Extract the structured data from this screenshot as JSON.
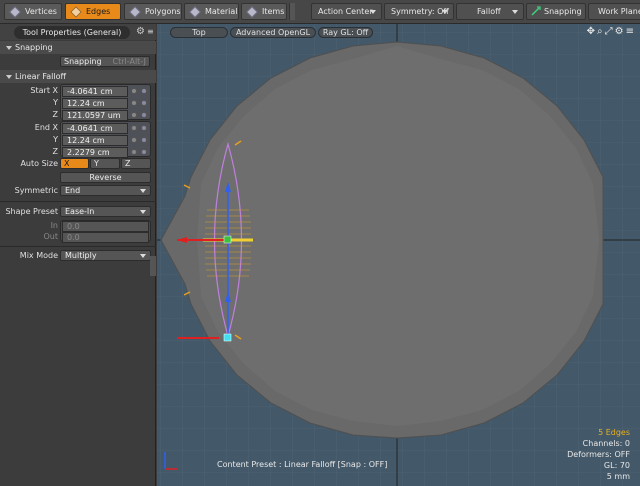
{
  "toolbar": {
    "modes": [
      {
        "label": "Vertices",
        "active": false
      },
      {
        "label": "Edges",
        "active": true
      },
      {
        "label": "Polygons",
        "active": false
      },
      {
        "label": "Materials",
        "active": false
      },
      {
        "label": "Items",
        "active": false
      }
    ],
    "action_center": "Action Center",
    "symmetry": "Symmetry: Off",
    "falloff": "Falloff",
    "snapping": "Snapping",
    "work_plane": "Work Plane"
  },
  "panel": {
    "title": "Tool Properties (General)",
    "snapping_section": "Snapping",
    "snapping_button": "Snapping",
    "snapping_shortcut": "Ctrl-Alt-J",
    "linear_falloff_section": "Linear Falloff",
    "start": {
      "label": "Start X",
      "y_label": "Y",
      "z_label": "Z",
      "x": "-4.0641 cm",
      "y": "12.24 cm",
      "z": "121.0597 um"
    },
    "end": {
      "label": "End X",
      "y_label": "Y",
      "z_label": "Z",
      "x": "-4.0641 cm",
      "y": "12.24 cm",
      "z": "2.2279 cm"
    },
    "auto_size_label": "Auto Size",
    "auto_size": {
      "x": "X",
      "y": "Y",
      "z": "Z"
    },
    "reverse_label": "Reverse",
    "symmetric_label": "Symmetric",
    "symmetric_value": "End",
    "shape_preset_label": "Shape Preset",
    "shape_preset_value": "Ease-In",
    "in_label": "In",
    "in_value": "0.0",
    "out_label": "Out",
    "out_value": "0.0",
    "mix_mode_label": "Mix Mode",
    "mix_mode_value": "Multiply"
  },
  "viewport": {
    "view_label": "Top",
    "shading_label": "Advanced OpenGL",
    "raygl_label": "Ray GL: Off",
    "stats": {
      "edges": "5 Edges",
      "channels": "Channels: 0",
      "deformers": "Deformers: OFF",
      "gl": "GL: 70",
      "scale": "5 mm"
    },
    "preset_status": "Content Preset : Linear Falloff  [Snap : OFF]"
  },
  "colors": {
    "accent": "#e88a1a",
    "viewport_bg": "#435868",
    "mesh": "#696969",
    "falloff": "#c080e0",
    "selected_edge": "#f0d030"
  }
}
